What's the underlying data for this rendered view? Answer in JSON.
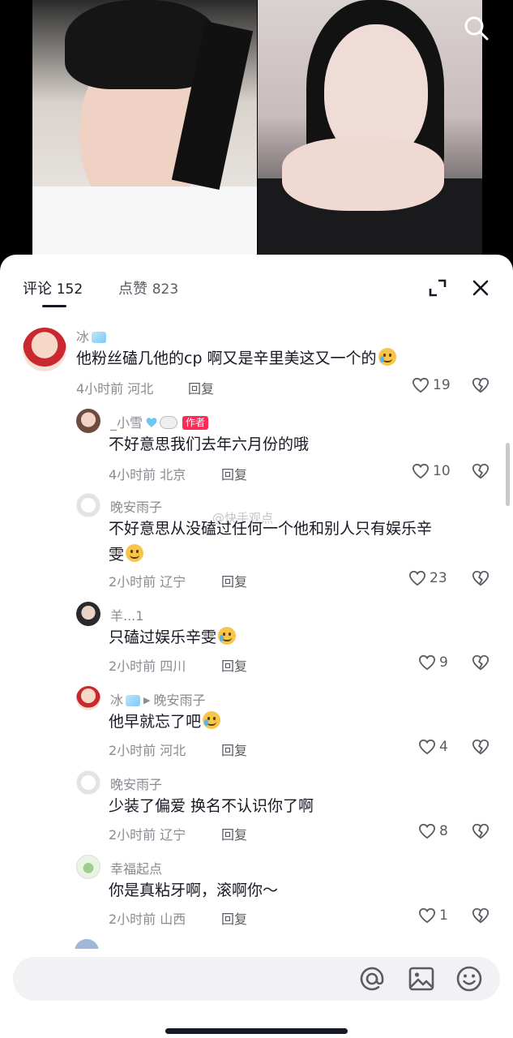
{
  "video": {
    "left_stream": "host-left",
    "right_stream": "host-right",
    "search_icon": "search-icon"
  },
  "tabs": {
    "comments_label": "评论",
    "comments_count": "152",
    "likes_label": "点赞",
    "likes_count": "823",
    "expand_icon": "expand-icon",
    "close_icon": "close-icon"
  },
  "watermark": "@快手观点",
  "comments": [
    {
      "user": "冰",
      "text": "他粉丝磕几他的cp 啊又是辛里美这又一个的",
      "time": "4小时前",
      "location": "河北",
      "reply_label": "回复",
      "likes": "19"
    },
    {
      "user": "_小雪",
      "badge": "作者",
      "text": "不好意思我们去年六月份的哦",
      "time": "4小时前",
      "location": "北京",
      "reply_label": "回复",
      "likes": "10"
    },
    {
      "user": "晚安雨子",
      "text_line1": "不好意思从没磕过任何一个他和别人只有娱乐辛",
      "text_line2": "雯",
      "time": "2小时前",
      "location": "辽宁",
      "reply_label": "回复",
      "likes": "23"
    },
    {
      "user": "羊...1",
      "text": "只磕过娱乐辛雯",
      "time": "2小时前",
      "location": "四川",
      "reply_label": "回复",
      "likes": "9"
    },
    {
      "user": "冰",
      "reply_to": "晚安雨子",
      "text": "他早就忘了吧",
      "time": "2小时前",
      "location": "河北",
      "reply_label": "回复",
      "likes": "4"
    },
    {
      "user": "晚安雨子",
      "text": "少装了偏爱 换名不认识你了啊",
      "time": "2小时前",
      "location": "辽宁",
      "reply_label": "回复",
      "likes": "8"
    },
    {
      "user": "幸福起点",
      "text": "你是真粘牙啊，滚啊你～",
      "time": "2小时前",
      "location": "山西",
      "reply_label": "回复",
      "likes": "1"
    }
  ],
  "input": {
    "placeholder": "",
    "at_icon": "at-icon",
    "image_icon": "image-icon",
    "emoji_icon": "emoji-icon"
  },
  "colors": {
    "accent": "#fe2c55",
    "text_primary": "#161823",
    "text_secondary": "#8a8b91"
  }
}
